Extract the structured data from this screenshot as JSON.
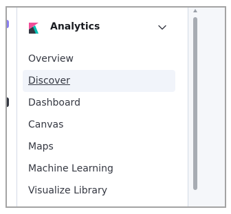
{
  "nav_group": {
    "title": "Analytics",
    "logo_icon": "kibana-logo-icon",
    "collapse_icon": "chevron-down-icon",
    "expanded": true
  },
  "nav_items": [
    {
      "label": "Overview",
      "active": false
    },
    {
      "label": "Discover",
      "active": true
    },
    {
      "label": "Dashboard",
      "active": false
    },
    {
      "label": "Canvas",
      "active": false
    },
    {
      "label": "Maps",
      "active": false
    },
    {
      "label": "Machine Learning",
      "active": false
    },
    {
      "label": "Visualize Library",
      "active": false
    }
  ],
  "colors": {
    "logo_pink": "#f04e98",
    "logo_teal": "#00bfb3",
    "logo_dark": "#343741",
    "active_bg": "#f1f4fa",
    "text": "#343741"
  }
}
